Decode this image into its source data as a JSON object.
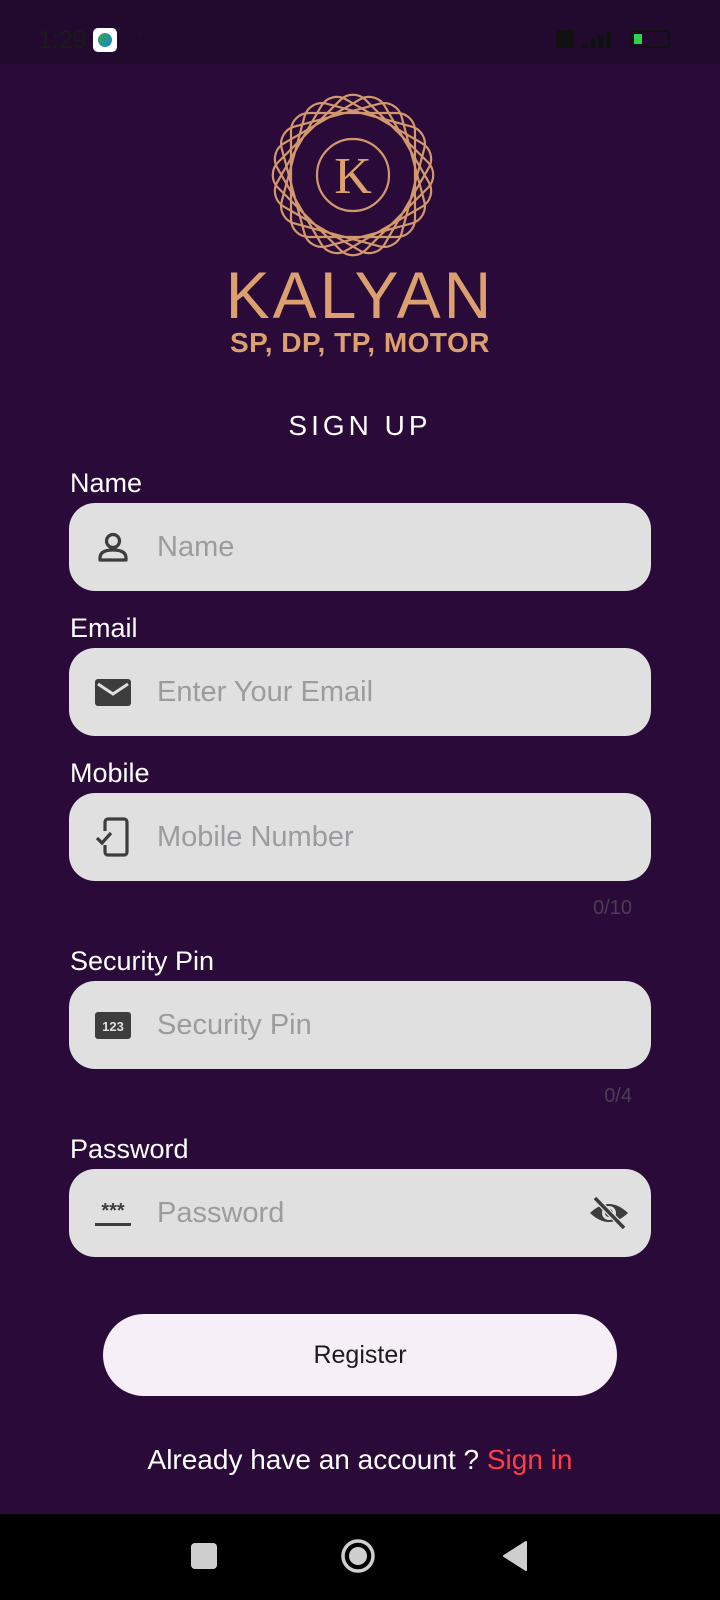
{
  "status_bar": {
    "time": "1:29",
    "dots": "··"
  },
  "brand": {
    "logo_letter": "K",
    "name": "KALYAN",
    "subtitle": "SP, DP, TP, MOTOR"
  },
  "title": "SIGN UP",
  "fields": {
    "name": {
      "label": "Name",
      "placeholder": "Name"
    },
    "email": {
      "label": "Email",
      "placeholder": "Enter Your Email"
    },
    "mobile": {
      "label": "Mobile",
      "placeholder": "Mobile Number",
      "counter": "0/10"
    },
    "security_pin": {
      "label": "Security Pin",
      "placeholder": "Security Pin",
      "counter": "0/4",
      "icon_text": "123"
    },
    "password": {
      "label": "Password",
      "placeholder": "Password",
      "icon_text": "***"
    }
  },
  "register_label": "Register",
  "signin": {
    "prompt": "Already have an account ? ",
    "link": "Sign in"
  },
  "colors": {
    "background": "#2a0a38",
    "gold": "#dca06f",
    "field": "#e0e0e1",
    "link": "#ff3d45"
  }
}
